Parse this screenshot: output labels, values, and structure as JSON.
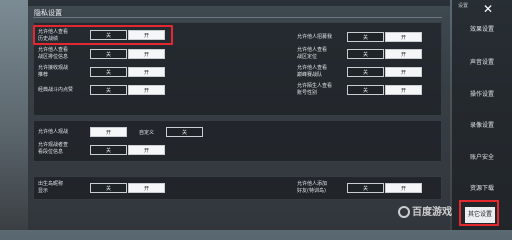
{
  "title": "隐私设置",
  "sidebar": {
    "top_label": "设置",
    "close_symbol": "✕",
    "items": [
      "效果设置",
      "声音设置",
      "操作设置",
      "录像设置",
      "账户安全",
      "资源下载"
    ],
    "active": "其它设置"
  },
  "section1": {
    "left": [
      {
        "label_l1": "允许他人查看",
        "label_l2": "历史战绩",
        "off": "关",
        "on": "开"
      },
      {
        "label_l1": "允许他人查看",
        "label_l2": "战区排位信息",
        "off": "关",
        "on": "开"
      },
      {
        "label_l1": "允许接收观战",
        "label_l2": "推荐",
        "off": "关",
        "on": "开"
      },
      {
        "label_l1": "经典战斗内点赞",
        "label_l2": "",
        "off": "关",
        "on": "开"
      }
    ],
    "right": [
      {
        "label_l1": "允许他人招募我",
        "label_l2": "",
        "off": "关",
        "on": "开"
      },
      {
        "label_l1": "允许他人查看",
        "label_l2": "战区定位",
        "off": "关",
        "on": "开"
      },
      {
        "label_l1": "允许他人查看",
        "label_l2": "巅峰赛战队",
        "off": "关",
        "on": "开"
      },
      {
        "label_l1": "允许陌生人查看",
        "label_l2": "账号性别",
        "off": "关",
        "on": "开"
      }
    ]
  },
  "section2": {
    "row1": {
      "label": "允许他人观战",
      "on": "开",
      "custom": "自定义",
      "off": "关"
    },
    "row2": {
      "label_l1": "允许观战者查",
      "label_l2": "看段位信息",
      "off": "关",
      "on": "开"
    }
  },
  "section3": {
    "left": {
      "label_l1": "出生岛昵称",
      "label_l2": "显示",
      "off": "关",
      "on": "开"
    },
    "right": {
      "label_l1": "允许他人添加",
      "label_l2": "好友(特训岛)",
      "off": "关",
      "on": "开"
    }
  },
  "watermark": "百度游戏"
}
